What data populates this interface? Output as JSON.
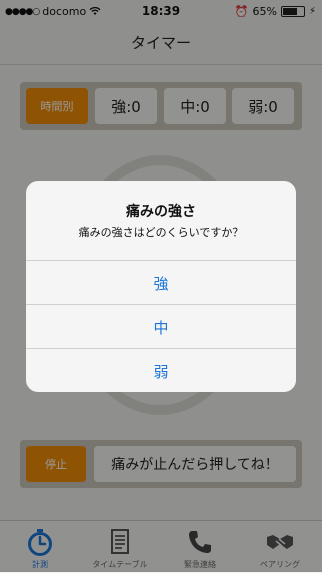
{
  "statusbar": {
    "carrier": "docomo",
    "time": "18:39",
    "battery": "65%",
    "signal_dots": "●●●●○"
  },
  "navbar": {
    "title": "タイマー"
  },
  "top_panel": {
    "mode_button": "時間別",
    "strong_count": "強:0",
    "medium_count": "中:0",
    "weak_count": "弱:0"
  },
  "bottom_panel": {
    "stop_button": "停止",
    "message_button": "痛みが止んだら押してね！"
  },
  "tabbar": {
    "tabs": [
      {
        "label": "計測",
        "icon": "stopwatch-icon",
        "active": true
      },
      {
        "label": "タイムテーブル",
        "icon": "document-icon",
        "active": false
      },
      {
        "label": "緊急連絡",
        "icon": "phone-icon",
        "active": false
      },
      {
        "label": "ペアリング",
        "icon": "handshake-icon",
        "active": false
      }
    ]
  },
  "alert": {
    "title": "痛みの強さ",
    "message": "痛みの強さはどのくらいですか？",
    "options": [
      "強",
      "中",
      "弱"
    ]
  },
  "colors": {
    "accent_orange": "#ef8a08",
    "ios_blue": "#1b75d6",
    "panel_gray": "#c9c4b8"
  }
}
